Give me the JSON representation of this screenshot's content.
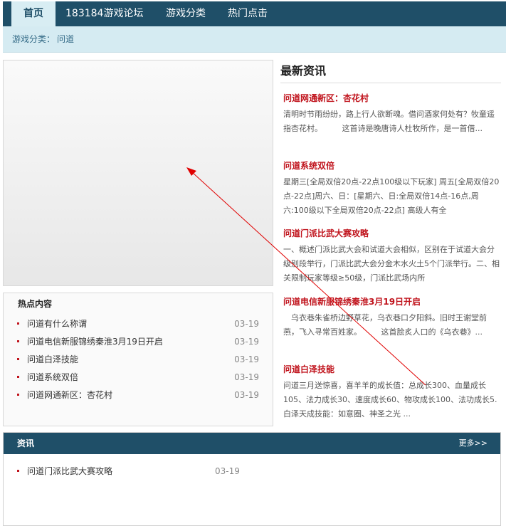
{
  "nav": {
    "home": "首页",
    "forum": "183184游戏论坛",
    "category": "游戏分类",
    "hot": "热门点击"
  },
  "breadcrumb": {
    "label": "游戏分类：",
    "value": "问道"
  },
  "latest": {
    "title": "最新资讯",
    "items": [
      {
        "title": "问道网通新区：杏花村",
        "desc": "清明时节雨纷纷，路上行人欲断魂。借问酒家何处有？牧童遥指杏花村。　　　这首诗是晚唐诗人杜牧所作，是一首借..."
      },
      {
        "title": "问道系统双倍",
        "desc": "星期三[全局双倍20点-22点100级以下玩家] 周五[全局双倍20点-22点]周六、日：[星期六、日:全局双倍14点-16点,周六:100级以下全局双倍20点-22点] 高级人有全"
      },
      {
        "title": "问道门派比武大赛攻略",
        "desc": "一、概述门派比武大会和试道大会相似，区别在于试道大会分级别段举行，门派比武大会分金木水火土5个门派举行。二、相关限制玩家等级≥50级，门派比武场内所"
      },
      {
        "title": "问道电信新服锦绣秦淮3月19日开启",
        "desc": "　乌衣巷朱雀桥边野草花，乌衣巷口夕阳斜。旧时王谢堂前燕，飞入寻常百姓家。　　　这首脍炙人口的《乌衣巷》..."
      },
      {
        "title": "问道白泽技能",
        "desc": "问道三月送惊喜，喜羊羊的成长值：总成长300、血量成长105、法力成长30、速度成长60、物攻成长100、法功成长5.白泽天成技能：如意圈、神圣之光 ..."
      }
    ]
  },
  "hot": {
    "title": "热点内容",
    "items": [
      {
        "text": "问道有什么称谓",
        "date": "03-19"
      },
      {
        "text": "问道电信新服锦绣秦淮3月19日开启",
        "date": "03-19"
      },
      {
        "text": "问道白泽技能",
        "date": "03-19"
      },
      {
        "text": "问道系统双倍",
        "date": "03-19"
      },
      {
        "text": "问道网通新区：杏花村",
        "date": "03-19"
      }
    ]
  },
  "info": {
    "title": "资讯",
    "more": "更多>>",
    "items": [
      {
        "text": "问道门派比武大赛攻略",
        "date": "03-19"
      }
    ]
  },
  "colors": {
    "nav_bg": "#1f4f68",
    "crumb_bg": "#d5ebf2",
    "headline_red": "#c0131c",
    "arrow_red": "#e00000"
  }
}
